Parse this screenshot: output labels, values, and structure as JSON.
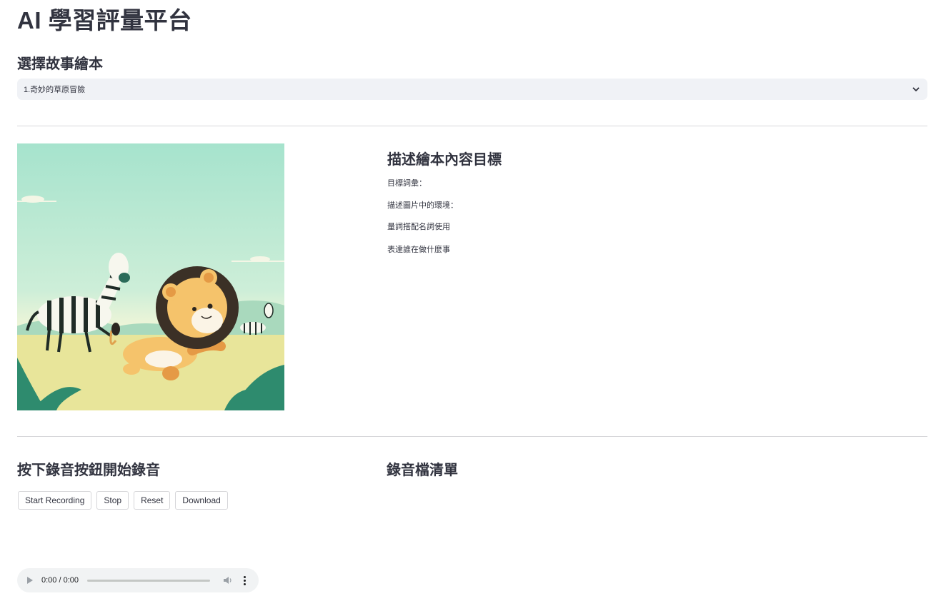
{
  "app": {
    "title": "AI 學習評量平台"
  },
  "story_select": {
    "title": "選擇故事繪本",
    "selected_value": "1.奇妙的草原冒險",
    "chevron_icon": "chevron-down-icon"
  },
  "story_image": {
    "alt": "卡通獅子與斑馬在草原上奔跑",
    "colors": {
      "sky_top": "#a6e3cd",
      "sky_bottom": "#f7f7d8",
      "grass": "#e8e59a",
      "hill": "#a9d9bd",
      "leaf": "#2e8b6e",
      "lion_body": "#f5c36b",
      "lion_mane": "#3b3026"
    }
  },
  "goals": {
    "title": "描述繪本內容目標",
    "items": [
      "目標詞彙：",
      "描述圖片中的環境：",
      "量詞搭配名詞使用",
      "表達誰在做什麼事"
    ]
  },
  "recording": {
    "title": "按下錄音按鈕開始錄音",
    "buttons": {
      "start": "Start Recording",
      "stop": "Stop",
      "reset": "Reset",
      "download": "Download"
    }
  },
  "recording_list": {
    "title": "錄音檔清單"
  },
  "audio_player": {
    "time": "0:00 / 0:00",
    "progress": 0,
    "play_icon": "play-icon",
    "volume_icon": "volume-icon",
    "menu_icon": "more-vert-icon"
  }
}
